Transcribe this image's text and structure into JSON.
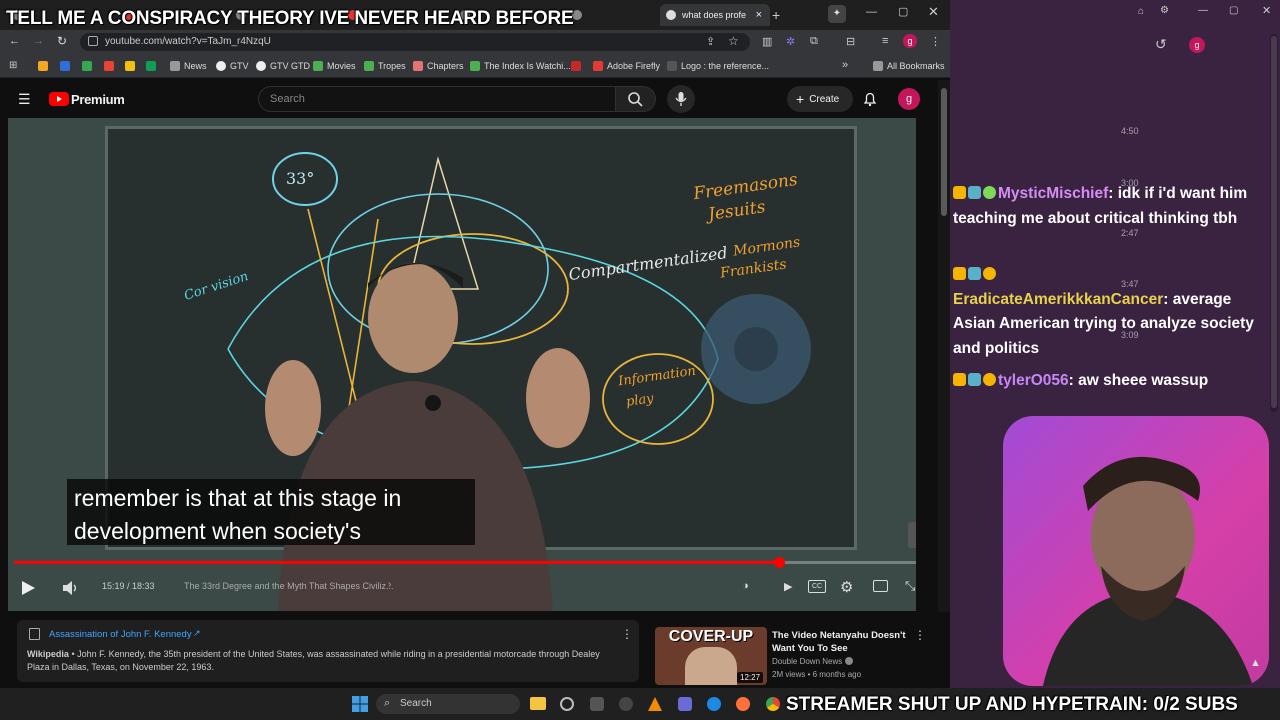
{
  "overlay": {
    "title": "TELL ME A CONSPIRACY THEORY IVE NEVER HEARD BEFORE",
    "subs_goal": "STREAMER SHUT UP AND HYPETRAIN: 0/2 SUBS"
  },
  "browser": {
    "active_tab_title": "what does profe",
    "url": "youtube.com/watch?v=TaJm_r4NzqU",
    "bookmarks": [
      "News",
      "GTV",
      "GTV GTD",
      "Movies",
      "Tropes",
      "Chapters",
      "The Index Is Watchi...",
      "Adobe Firefly",
      "Logo : the reference..."
    ],
    "all_bookmarks": "All Bookmarks"
  },
  "youtube": {
    "logo": "Premium",
    "search_placeholder": "Search",
    "create_label": "Create",
    "avatar_letter": "g"
  },
  "player": {
    "caption_line1": "remember is that at this stage in",
    "caption_line2": "development when society's",
    "time": "15:19 / 18:33",
    "chapter": "The 33rd Degree and the Myth That Shapes Civiliz...",
    "progress": 0.848,
    "board_text": {
      "circle": "33°",
      "top_right_1": "Freemasons",
      "top_right_2": "Jesuits",
      "middle": "Compartmentalized",
      "right_1": "Mormons",
      "right_2": "Frankists",
      "left": "Cor vision",
      "low_1": "Information",
      "low_2": "play"
    }
  },
  "info_card": {
    "title": "Assassination of John F. Kennedy",
    "source": "Wikipedia",
    "text": "John F. Kennedy, the 35th president of the United States, was assassinated while riding in a presidential motorcade through Dealey Plaza in Dallas, Texas, on November 22, 1963."
  },
  "recommendation": {
    "thumb_text": "COVER-UP",
    "duration": "12:27",
    "title_line1": "The Video Netanyahu Doesn't",
    "title_line2": "Want You To See",
    "channel": "Double Down News",
    "meta": "2M views • 6 months ago"
  },
  "taskbar": {
    "search": "Search"
  },
  "chat": {
    "profile_letter": "g",
    "timestamps": [
      "4:50",
      "3:00",
      "2:47",
      "3:47",
      "3:09"
    ],
    "messages": [
      {
        "user": "MysticMischief",
        "color": "#d68cf5",
        "text": "idk if i'd want him teaching me about critical thinking tbh"
      },
      {
        "user": "EradicateAmerikkkanCancer",
        "color": "#e8d14a",
        "text": "average Asian American trying to analyze society and politics"
      },
      {
        "user": "tylerO056",
        "color": "#c786f5",
        "text": "aw sheee wassup"
      }
    ]
  },
  "colors": {
    "youtube_red": "#ff0000",
    "chat_bg": "#3a2340",
    "chalk_yellow": "#e8b53a",
    "chalk_cyan": "#5ad6e0"
  }
}
